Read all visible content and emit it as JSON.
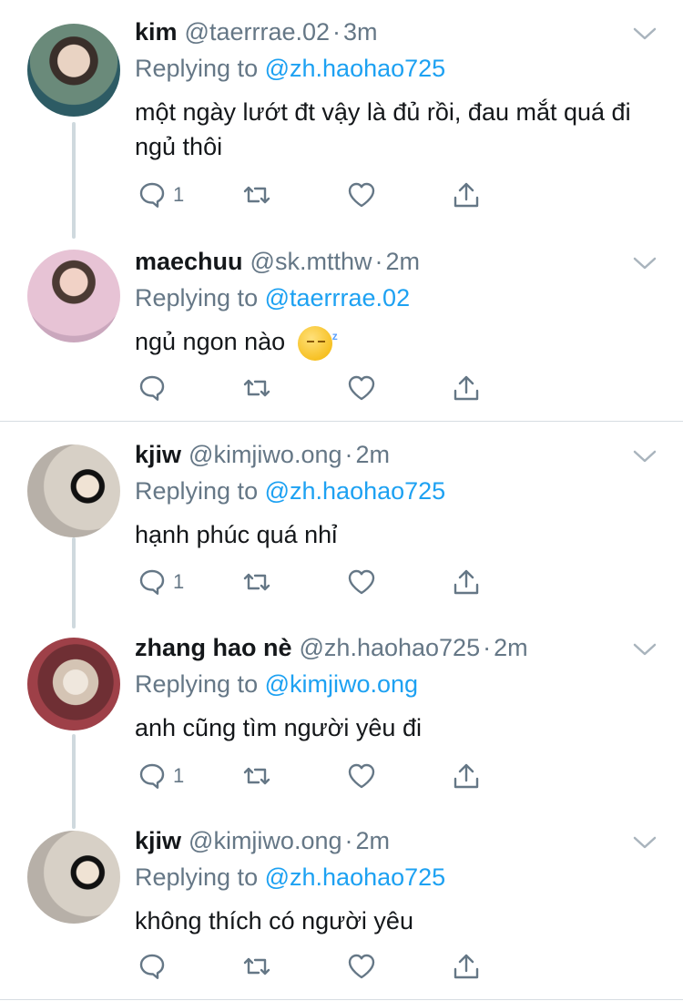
{
  "tweets": [
    {
      "name": "kim",
      "handle": "@taerrrae.02",
      "time": "3m",
      "replying_prefix": "Replying to",
      "replying_to": "@zh.haohao725",
      "text": "một ngày lướt đt vậy là đủ rồi, đau mắt quá đi ngủ thôi",
      "reply_count": "1"
    },
    {
      "name": "maechuu",
      "handle": "@sk.mtthw",
      "time": "2m",
      "replying_prefix": "Replying to",
      "replying_to": "@taerrrae.02",
      "text": "ngủ ngon nào",
      "emoji": "sleeping-face",
      "reply_count": ""
    },
    {
      "name": "kjiw",
      "handle": "@kimjiwo.ong",
      "time": "2m",
      "replying_prefix": "Replying to",
      "replying_to": "@zh.haohao725",
      "text": "hạnh phúc quá nhỉ",
      "reply_count": "1"
    },
    {
      "name": "zhang hao nè",
      "handle": "@zh.haohao725",
      "time": "2m",
      "replying_prefix": "Replying to",
      "replying_to": "@kimjiwo.ong",
      "text": "anh cũng tìm người yêu đi",
      "reply_count": "1"
    },
    {
      "name": "kjiw",
      "handle": "@kimjiwo.ong",
      "time": "2m",
      "replying_prefix": "Replying to",
      "replying_to": "@zh.haohao725",
      "text": "không thích có người yêu",
      "reply_count": ""
    }
  ],
  "icons": {
    "reply": "comment-icon",
    "retweet": "retweet-icon",
    "like": "heart-icon",
    "share": "share-icon",
    "more": "chevron-down-icon"
  },
  "colors": {
    "link": "#1da1f2",
    "secondary_text": "#657786",
    "thread_line": "#cfd9de"
  },
  "separator": "·"
}
